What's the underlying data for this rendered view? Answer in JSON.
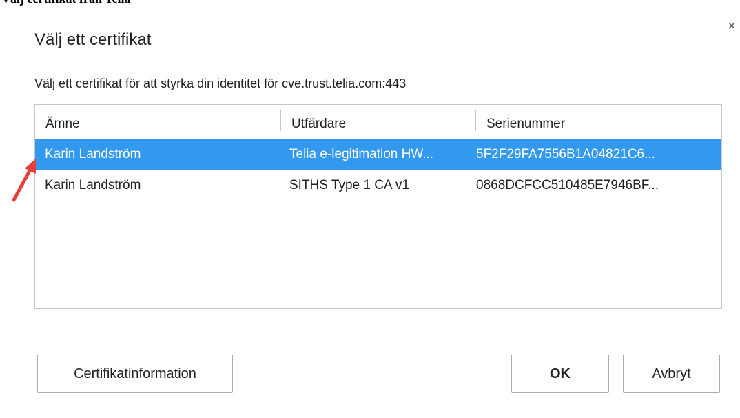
{
  "page": {
    "caption": "Välj certifikat från Telia"
  },
  "dialog": {
    "title": "Välj ett certifikat",
    "prompt": "Välj ett certifikat för att styrka din identitet för cve.trust.telia.com:443",
    "close_glyph": "×"
  },
  "table": {
    "columns": [
      "Ämne",
      "Utfärdare",
      "Serienummer"
    ],
    "rows": [
      {
        "subject": "Karin Landström",
        "issuer": "Telia e-legitimation HW...",
        "serial": "5F2F29FA7556B1A04821C6...",
        "selected": true
      },
      {
        "subject": "Karin Landström",
        "issuer": "SITHS Type 1 CA v1",
        "serial": "0868DCFCC510485E7946BF...",
        "selected": false
      }
    ]
  },
  "buttons": {
    "info": "Certifikatinformation",
    "ok": "OK",
    "cancel": "Avbryt"
  },
  "colors": {
    "selection": "#3399ee",
    "annotation_arrow": "#e8413b"
  },
  "annotation": {
    "icon": "red-arrow-pointer-icon"
  }
}
